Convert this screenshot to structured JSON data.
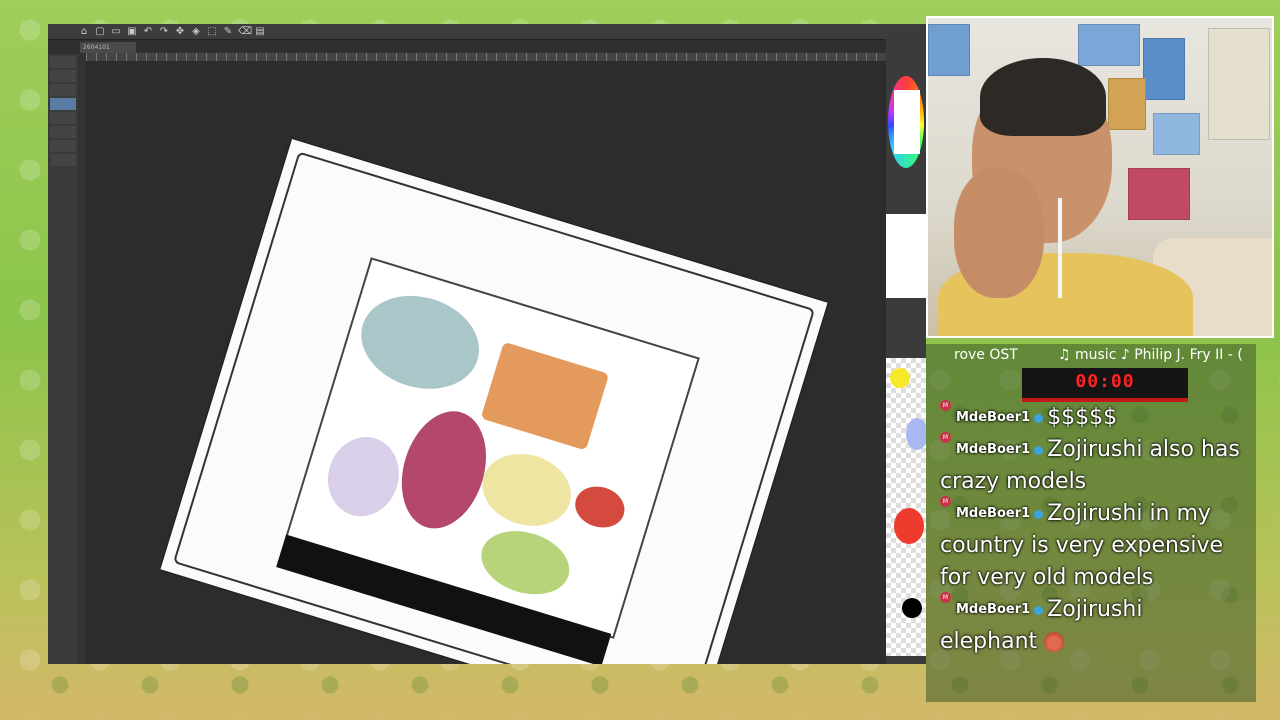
{
  "app": {
    "doc_tab_label": "2604101"
  },
  "music": {
    "ticker_left": "rove OST",
    "ticker_right": "♫ music ♪ Philip J. Fry II - ("
  },
  "timer": {
    "value": "00:00"
  },
  "chat": {
    "messages": [
      {
        "user": "MdeBoer1",
        "text": "$$$$$"
      },
      {
        "user": "MdeBoer1",
        "text": "Zojirushi also has crazy models"
      },
      {
        "user": "MdeBoer1",
        "text": "Zojirushi in my country is very expensive for very old models"
      },
      {
        "user": "MdeBoer1",
        "text": "Zojirushi elephant",
        "emote": "elephant-emote-icon"
      }
    ],
    "badge_label": "M"
  },
  "icons": {
    "toolbar": [
      "home-icon",
      "new-file-icon",
      "open-icon",
      "save-icon",
      "undo-icon",
      "redo-icon",
      "transform-icon",
      "fill-icon",
      "select-icon",
      "pen-icon",
      "eraser-icon",
      "layer-icon"
    ]
  },
  "colors": {
    "timer_red": "#ff2222",
    "chat_bg": "rgba(60,90,40,0.55)",
    "background_green": "#8cc44b"
  }
}
